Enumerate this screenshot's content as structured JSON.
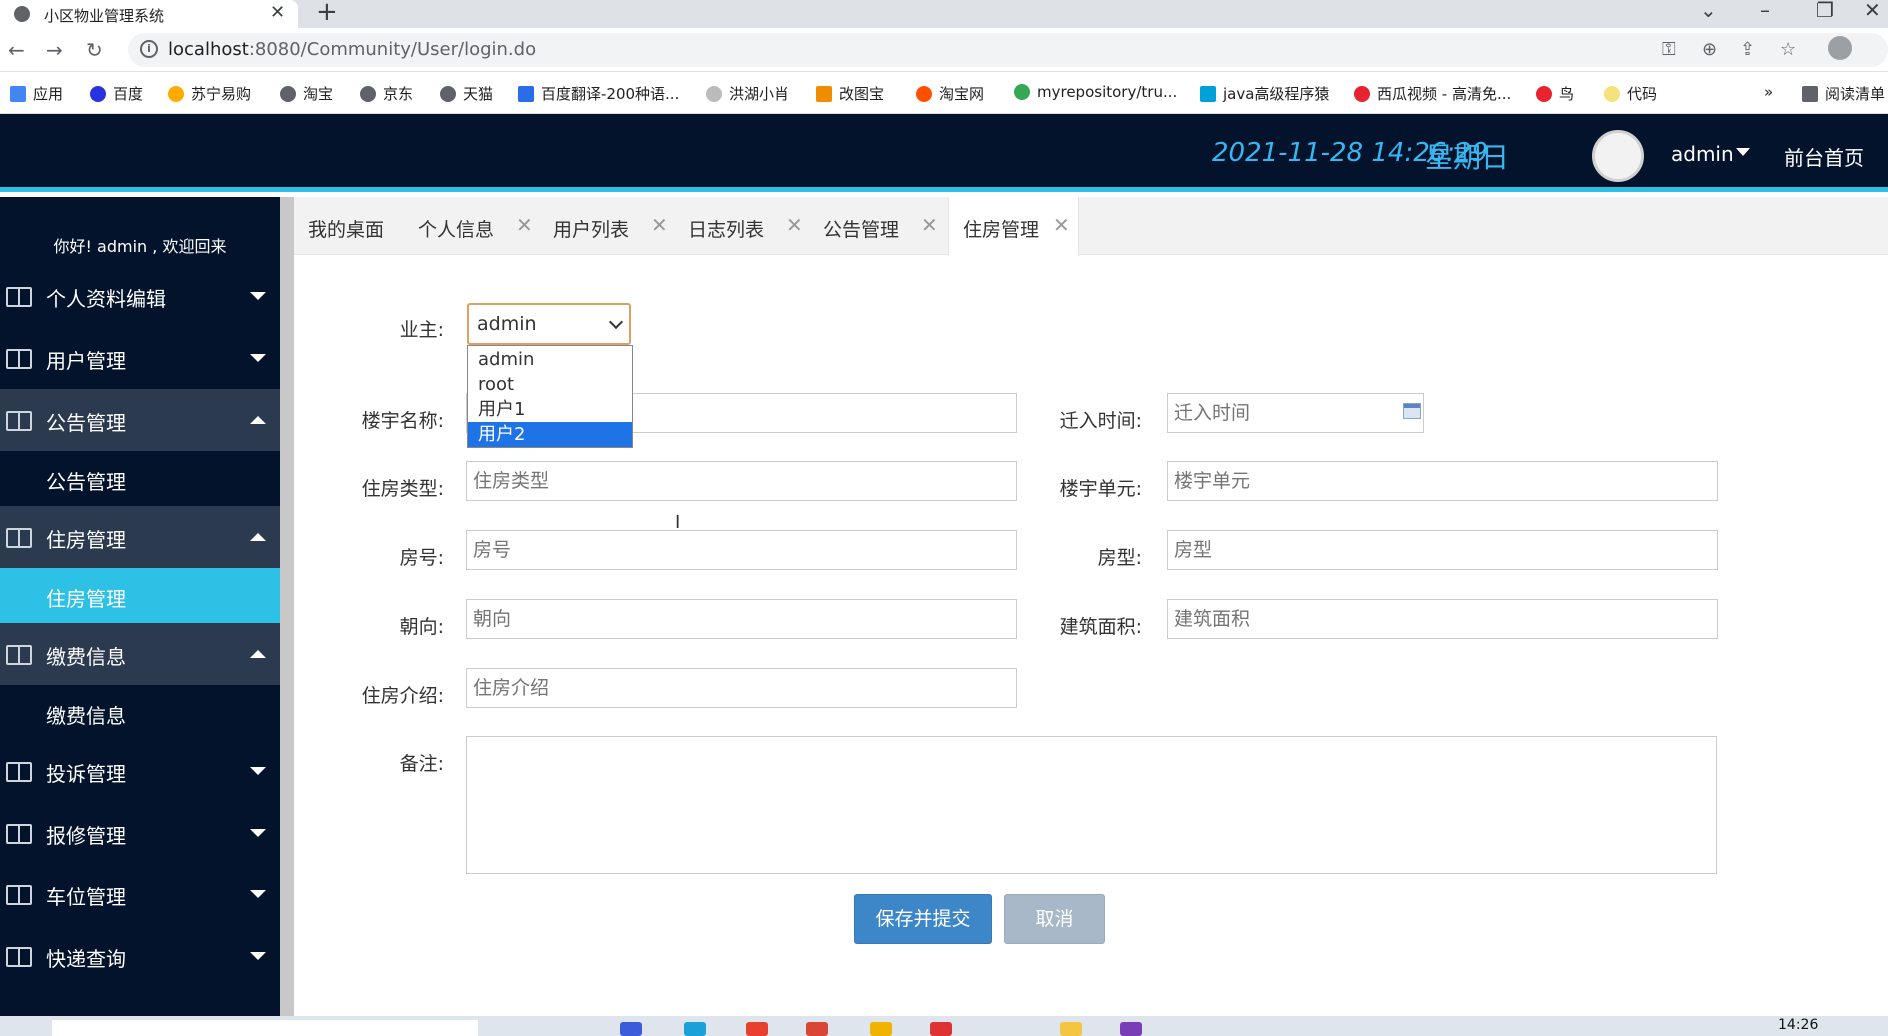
{
  "browser": {
    "tab_title": "小区物业管理系统",
    "tab_close": "✕",
    "new_tab": "+",
    "url_host": "localhost",
    "url_rest": ":8080/Community/User/login.do",
    "bookmarks": [
      "应用",
      "百度",
      "苏宁易购",
      "淘宝",
      "京东",
      "天猫",
      "百度翻译-200种语...",
      "洪湖小肖",
      "改图宝",
      "淘宝网",
      "myrepository/tru...",
      "java高级程序猿",
      "西瓜视频 - 高清免...",
      "鸟",
      "代码"
    ],
    "bookmarks_more": "»",
    "reading_list": "阅读清单"
  },
  "header": {
    "datetime": "2021-11-28  14:26:29",
    "weekday": "星期日",
    "username": "admin",
    "front_page": "前台首页"
  },
  "sidebar": {
    "welcome": "你好!  admin , 欢迎回来",
    "items": [
      {
        "label": "个人资料编辑",
        "expanded": false
      },
      {
        "label": "用户管理",
        "expanded": false
      },
      {
        "label": "公告管理",
        "expanded": true,
        "sub": "公告管理"
      },
      {
        "label": "住房管理",
        "expanded": true,
        "sub": "住房管理"
      },
      {
        "label": "缴费信息",
        "expanded": true,
        "sub": "缴费信息"
      },
      {
        "label": "投诉管理",
        "expanded": false
      },
      {
        "label": "报修管理",
        "expanded": false
      },
      {
        "label": "车位管理",
        "expanded": false
      },
      {
        "label": "快递查询",
        "expanded": false
      }
    ]
  },
  "tabs": [
    {
      "label": "我的桌面"
    },
    {
      "label": "个人信息"
    },
    {
      "label": "用户列表"
    },
    {
      "label": "日志列表"
    },
    {
      "label": "公告管理"
    },
    {
      "label": "住房管理"
    }
  ],
  "tab_close": "✕",
  "form": {
    "owner_label": "业主:",
    "owner_value": "admin",
    "owner_options": [
      "admin",
      "root",
      "用户1",
      "用户2"
    ],
    "owner_highlighted": "用户2",
    "building_label": "楼宇名称:",
    "move_in_label": "迁入时间:",
    "move_in_placeholder": "迁入时间",
    "house_type_label": "住房类型:",
    "house_type_placeholder": "住房类型",
    "unit_label": "楼宇单元:",
    "unit_placeholder": "楼宇单元",
    "room_no_label": "房号:",
    "room_no_placeholder": "房号",
    "layout_label": "房型:",
    "layout_placeholder": "房型",
    "orientation_label": "朝向:",
    "orientation_placeholder": "朝向",
    "area_label": "建筑面积:",
    "area_placeholder": "建筑面积",
    "intro_label": "住房介绍:",
    "intro_placeholder": "住房介绍",
    "remark_label": "备注:",
    "save_button": "保存并提交",
    "cancel_button": "取消"
  },
  "taskbar": {
    "clock": "14:26"
  },
  "colors": {
    "header_bg": "#04132c",
    "accent": "#2ec1e6",
    "datetime": "#38b6f0",
    "save_button": "#3d87c9",
    "cancel_button": "#a8b8c8",
    "dropdown_selected": "#1e73e6"
  }
}
